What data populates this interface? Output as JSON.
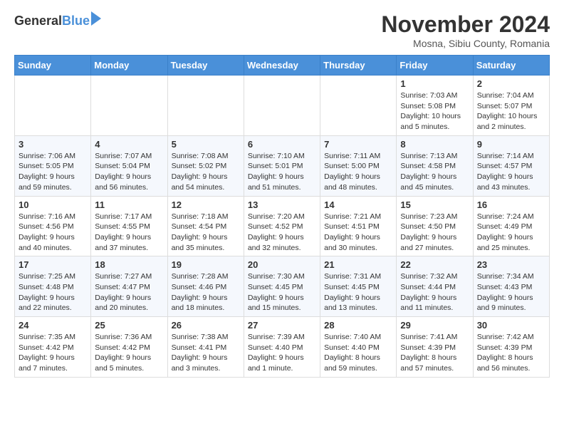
{
  "logo": {
    "general": "General",
    "blue": "Blue"
  },
  "header": {
    "title": "November 2024",
    "subtitle": "Mosna, Sibiu County, Romania"
  },
  "weekdays": [
    "Sunday",
    "Monday",
    "Tuesday",
    "Wednesday",
    "Thursday",
    "Friday",
    "Saturday"
  ],
  "weeks": [
    [
      {
        "day": "",
        "info": ""
      },
      {
        "day": "",
        "info": ""
      },
      {
        "day": "",
        "info": ""
      },
      {
        "day": "",
        "info": ""
      },
      {
        "day": "",
        "info": ""
      },
      {
        "day": "1",
        "info": "Sunrise: 7:03 AM\nSunset: 5:08 PM\nDaylight: 10 hours\nand 5 minutes."
      },
      {
        "day": "2",
        "info": "Sunrise: 7:04 AM\nSunset: 5:07 PM\nDaylight: 10 hours\nand 2 minutes."
      }
    ],
    [
      {
        "day": "3",
        "info": "Sunrise: 7:06 AM\nSunset: 5:05 PM\nDaylight: 9 hours\nand 59 minutes."
      },
      {
        "day": "4",
        "info": "Sunrise: 7:07 AM\nSunset: 5:04 PM\nDaylight: 9 hours\nand 56 minutes."
      },
      {
        "day": "5",
        "info": "Sunrise: 7:08 AM\nSunset: 5:02 PM\nDaylight: 9 hours\nand 54 minutes."
      },
      {
        "day": "6",
        "info": "Sunrise: 7:10 AM\nSunset: 5:01 PM\nDaylight: 9 hours\nand 51 minutes."
      },
      {
        "day": "7",
        "info": "Sunrise: 7:11 AM\nSunset: 5:00 PM\nDaylight: 9 hours\nand 48 minutes."
      },
      {
        "day": "8",
        "info": "Sunrise: 7:13 AM\nSunset: 4:58 PM\nDaylight: 9 hours\nand 45 minutes."
      },
      {
        "day": "9",
        "info": "Sunrise: 7:14 AM\nSunset: 4:57 PM\nDaylight: 9 hours\nand 43 minutes."
      }
    ],
    [
      {
        "day": "10",
        "info": "Sunrise: 7:16 AM\nSunset: 4:56 PM\nDaylight: 9 hours\nand 40 minutes."
      },
      {
        "day": "11",
        "info": "Sunrise: 7:17 AM\nSunset: 4:55 PM\nDaylight: 9 hours\nand 37 minutes."
      },
      {
        "day": "12",
        "info": "Sunrise: 7:18 AM\nSunset: 4:54 PM\nDaylight: 9 hours\nand 35 minutes."
      },
      {
        "day": "13",
        "info": "Sunrise: 7:20 AM\nSunset: 4:52 PM\nDaylight: 9 hours\nand 32 minutes."
      },
      {
        "day": "14",
        "info": "Sunrise: 7:21 AM\nSunset: 4:51 PM\nDaylight: 9 hours\nand 30 minutes."
      },
      {
        "day": "15",
        "info": "Sunrise: 7:23 AM\nSunset: 4:50 PM\nDaylight: 9 hours\nand 27 minutes."
      },
      {
        "day": "16",
        "info": "Sunrise: 7:24 AM\nSunset: 4:49 PM\nDaylight: 9 hours\nand 25 minutes."
      }
    ],
    [
      {
        "day": "17",
        "info": "Sunrise: 7:25 AM\nSunset: 4:48 PM\nDaylight: 9 hours\nand 22 minutes."
      },
      {
        "day": "18",
        "info": "Sunrise: 7:27 AM\nSunset: 4:47 PM\nDaylight: 9 hours\nand 20 minutes."
      },
      {
        "day": "19",
        "info": "Sunrise: 7:28 AM\nSunset: 4:46 PM\nDaylight: 9 hours\nand 18 minutes."
      },
      {
        "day": "20",
        "info": "Sunrise: 7:30 AM\nSunset: 4:45 PM\nDaylight: 9 hours\nand 15 minutes."
      },
      {
        "day": "21",
        "info": "Sunrise: 7:31 AM\nSunset: 4:45 PM\nDaylight: 9 hours\nand 13 minutes."
      },
      {
        "day": "22",
        "info": "Sunrise: 7:32 AM\nSunset: 4:44 PM\nDaylight: 9 hours\nand 11 minutes."
      },
      {
        "day": "23",
        "info": "Sunrise: 7:34 AM\nSunset: 4:43 PM\nDaylight: 9 hours\nand 9 minutes."
      }
    ],
    [
      {
        "day": "24",
        "info": "Sunrise: 7:35 AM\nSunset: 4:42 PM\nDaylight: 9 hours\nand 7 minutes."
      },
      {
        "day": "25",
        "info": "Sunrise: 7:36 AM\nSunset: 4:42 PM\nDaylight: 9 hours\nand 5 minutes."
      },
      {
        "day": "26",
        "info": "Sunrise: 7:38 AM\nSunset: 4:41 PM\nDaylight: 9 hours\nand 3 minutes."
      },
      {
        "day": "27",
        "info": "Sunrise: 7:39 AM\nSunset: 4:40 PM\nDaylight: 9 hours\nand 1 minute."
      },
      {
        "day": "28",
        "info": "Sunrise: 7:40 AM\nSunset: 4:40 PM\nDaylight: 8 hours\nand 59 minutes."
      },
      {
        "day": "29",
        "info": "Sunrise: 7:41 AM\nSunset: 4:39 PM\nDaylight: 8 hours\nand 57 minutes."
      },
      {
        "day": "30",
        "info": "Sunrise: 7:42 AM\nSunset: 4:39 PM\nDaylight: 8 hours\nand 56 minutes."
      }
    ]
  ]
}
